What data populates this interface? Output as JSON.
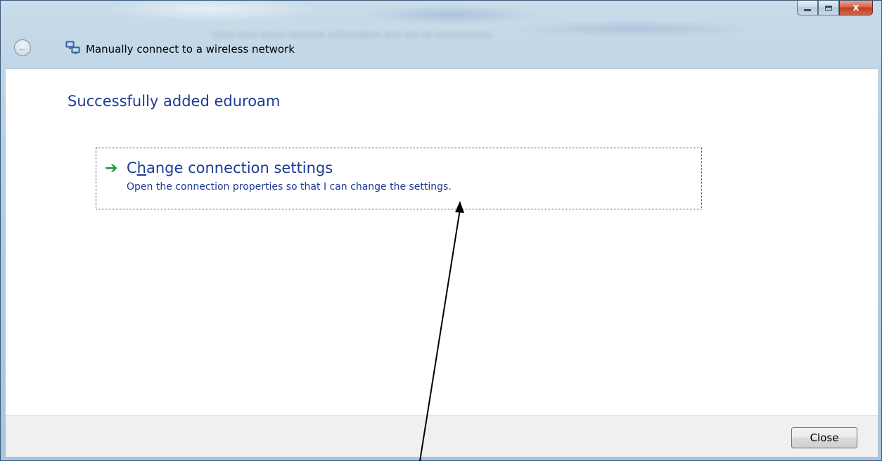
{
  "window": {
    "title": "Manually connect to a wireless network",
    "background_blur_text": "View your basic network information and set up connections",
    "caption_buttons": {
      "minimize_icon": "minimize-icon",
      "maximize_icon": "maximize-icon",
      "close_icon": "close-icon",
      "close_glyph": "x"
    }
  },
  "nav": {
    "back_icon": "back-arrow-icon",
    "back_glyph": "←",
    "wizard_icon": "network-connection-icon"
  },
  "main": {
    "heading": "Successfully added eduroam",
    "command_link": {
      "icon": "green-arrow-icon",
      "arrow_glyph": "➔",
      "title_pre": "C",
      "title_underlined": "h",
      "title_post": "ange connection settings",
      "description": "Open the connection properties so that I can change the settings."
    }
  },
  "footer": {
    "close_label": "Close"
  },
  "colors": {
    "link_blue": "#1e3a94",
    "arrow_green": "#1a9a3a",
    "close_red": "#c1401f",
    "footer_bg": "#f0f0f0"
  }
}
